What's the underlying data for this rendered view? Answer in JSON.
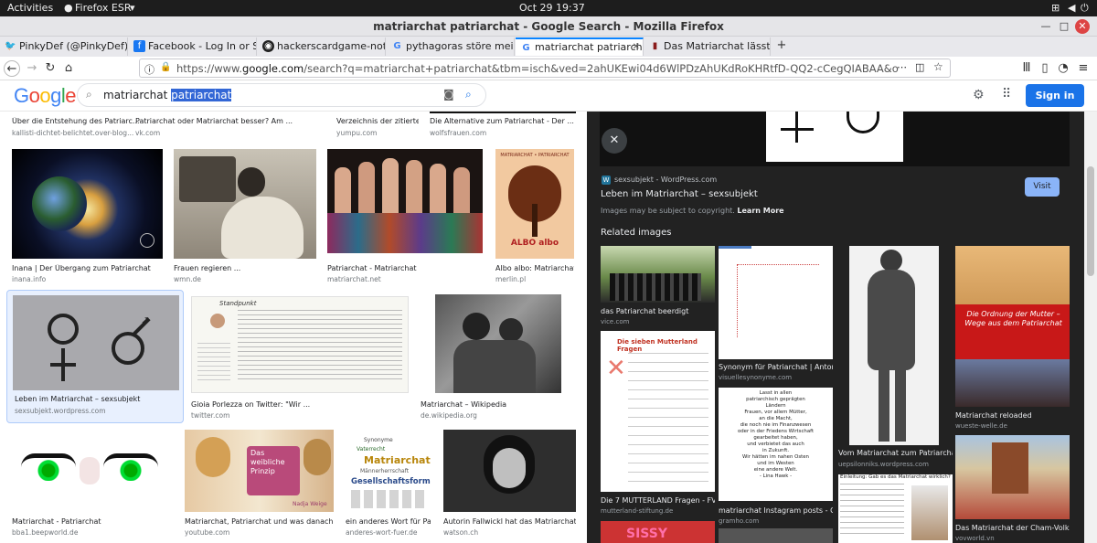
{
  "system": {
    "activities": "Activities",
    "app": "Firefox ESR",
    "clock": "Oct 29  19:37"
  },
  "window": {
    "title": "matriarchat patriarchat - Google Search - Mozilla Firefox"
  },
  "tabs": [
    {
      "label": "PinkyDef (@PinkyDef) / T",
      "icon": "twitter-icon",
      "color": "#1da1f2"
    },
    {
      "label": "Facebook - Log In or Sig",
      "icon": "facebook-icon",
      "color": "#1877f2"
    },
    {
      "label": "hackerscardgame-notes",
      "icon": "github-icon",
      "color": "#222222"
    },
    {
      "label": "pythagoras störe meine K",
      "icon": "google-icon",
      "color": "#4285f4"
    },
    {
      "label": "matriarchat patriarchat -",
      "icon": "google-icon",
      "color": "#4285f4"
    },
    {
      "label": "Das Matriarchat lässt grü",
      "icon": "page-icon",
      "color": "#8a1c1c"
    }
  ],
  "url": {
    "prefix": "https://www.",
    "domain": "google.com",
    "rest": "/search?q=matriarchat+patriarchat&tbm=isch&ved=2ahUKEwi04d6WlPDzAhUKdRoKHRtfD-QQ2-cCegQIABAA&oq=matriarchat+patriarchat&gs_lcp=CgNp"
  },
  "google": {
    "logo": [
      "G",
      "o",
      "o",
      "g",
      "l",
      "e"
    ],
    "logo_colors": [
      "#4285f4",
      "#ea4335",
      "#fbbc05",
      "#4285f4",
      "#34a853",
      "#ea4335"
    ],
    "query_plain": "matriarchat ",
    "query_selected": "patriarchat",
    "signin": "Sign in"
  },
  "results": {
    "row0": [
      {
        "cap": "Über die Entstehung des Patriarc...",
        "src": "kallisti-dichtet-belichtet.over-blog..."
      },
      {
        "cap": "Patriarchat oder Matriarchat besser? Am ...",
        "src": "vk.com"
      },
      {
        "cap": "Verzeichnis der zitierte...",
        "src": "yumpu.com"
      },
      {
        "cap": "Die Alternative zum Patriarchat - Der ...",
        "src": "wolfsfrauen.com"
      }
    ],
    "row1": [
      {
        "cap": "Inana | Der Übergang zum Patriarchat",
        "src": "inana.info"
      },
      {
        "cap": "Frauen regieren ...",
        "src": "wmn.de"
      },
      {
        "cap": "Patriarchat - Matriarchat",
        "src": "matriarchat.net"
      },
      {
        "cap": "Albo albo: Matriarchat ...",
        "src": "merlin.pl"
      }
    ],
    "row2": [
      {
        "cap": "Leben im Matriarchat – sexsubjekt",
        "src": "sexsubjekt.wordpress.com"
      },
      {
        "cap": "Gioia Porlezza on Twitter: \"Wir ...",
        "src": "twitter.com"
      },
      {
        "cap": "Matriarchat – Wikipedia",
        "src": "de.wikipedia.org"
      }
    ],
    "row3": [
      {
        "cap": "Matriarchat - Patriarchat",
        "src": "bba1.beepworld.de"
      },
      {
        "cap": "Matriarchat, Patriarchat und was danach ...",
        "src": "youtube.com"
      },
      {
        "cap": "ein anderes Wort für Pat...",
        "src": "anderes-wort-fuer.de"
      },
      {
        "cap": "Autorin Fallwickl hat das Matriarchat ...",
        "src": "watson.ch"
      }
    ],
    "img_text": {
      "albo_title": "MATRIARCHAT • PATRIARCHAT",
      "albo_brand": "ALBO albo",
      "prinzip_1": "Das",
      "prinzip_2": "weibliche",
      "prinzip_3": "Prinzip",
      "prinzip_name": "Nadja Weige",
      "wc_big": "Matriarchat",
      "wc_mid": "Gesellschaftsform",
      "wc_small1": "Synonyme",
      "wc_small2": "Vaterrecht",
      "wc_small3": "Männerherrschaft",
      "news_head": "Standpunkt"
    }
  },
  "panel": {
    "source": "sexsubjekt - WordPress.com",
    "title": "Leben im Matriarchat – sexsubjekt",
    "visit": "Visit",
    "copyright": "Images may be subject to copyright.",
    "learn_more": "Learn More",
    "related_heading": "Related images",
    "related": [
      {
        "cap": "das Patriarchat beerdigt",
        "src": "vice.com"
      },
      {
        "cap": "Synonym für Patriarchat | Antony...",
        "src": "visuellesynonyme.com"
      },
      {
        "cap": "Vom Matriarchat zum Patriarcha...",
        "src": "uepsilonniks.wordpress.com"
      },
      {
        "cap": "Matriarchat reloaded",
        "src": "wueste-welle.de"
      },
      {
        "cap": "Die 7 MUTTERLAND Fragen - FV ...",
        "src": "mutterland-stiftung.de"
      },
      {
        "cap": "matriarchat Instagram posts - Gr...",
        "src": "gramho.com"
      },
      {
        "cap": "Das Matriarchat der Cham-Volks...",
        "src": "vovworld.vn"
      }
    ],
    "rel_text": {
      "mutterland_title": "Die sieben Mutterland Fragen",
      "ordnung": "Die Ordnung der Mutter – Wege aus dem Patriarchat",
      "quote_1": "Lasst in allen",
      "quote_2": "patriarchisch geprägten",
      "quote_3": "Ländern",
      "quote_4": "Frauen, vor allem Mütter,",
      "quote_5": "an die Macht,",
      "quote_6": "die noch nie im Finanzwesen",
      "quote_7": "oder in der Friedens Wirtschaft",
      "quote_8": "gearbeitet haben,",
      "quote_9": "und verbietet das auch",
      "quote_10": "in Zukunft.",
      "quote_11": "Wir hätten im nahen Osten",
      "quote_12": "und im Westen",
      "quote_13": "eine andere Welt.",
      "quote_14": "- Lina Hawk -",
      "faq_head": "Einleitung: Gab es das Matriarchat wirklich?",
      "sissy": "SISSY"
    }
  }
}
